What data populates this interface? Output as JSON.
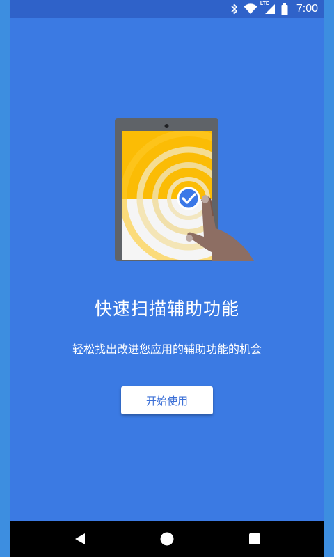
{
  "status_bar": {
    "time": "7:00",
    "network_label": "LTE",
    "icons": [
      "bluetooth-icon",
      "wifi-icon",
      "cell-signal-icon",
      "battery-icon"
    ]
  },
  "onboarding": {
    "illustration": "tablet-scan-illustration",
    "title": "快速扫描辅助功能",
    "subtitle": "轻松找出改进您应用的辅助功能的机会",
    "start_button_label": "开始使用"
  },
  "nav_bar": {
    "icons": [
      "back-icon",
      "home-icon",
      "recents-icon"
    ]
  },
  "colors": {
    "background": "#3b7ae3",
    "status_bar": "#2f62c9",
    "button_text": "#3b6fd6",
    "accent_yellow": "#fbbc05",
    "check_badge": "#3b78e7"
  }
}
